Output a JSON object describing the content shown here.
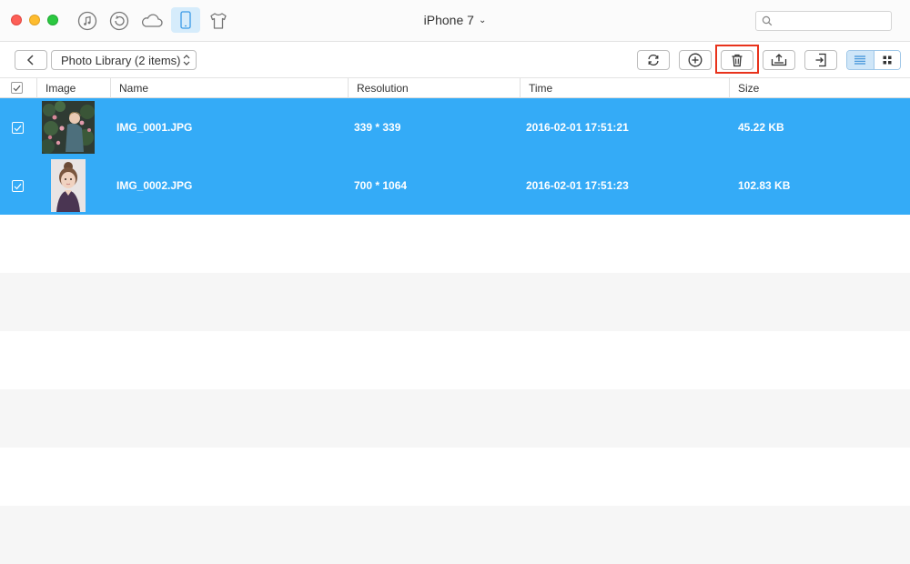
{
  "window": {
    "title": "iPhone 7",
    "search": {
      "placeholder": "",
      "value": ""
    }
  },
  "toolbar": {
    "library_label": "Photo Library (2 items)",
    "buttons": [
      "refresh-icon",
      "add-icon",
      "delete-icon",
      "export-icon",
      "send-to-device-icon"
    ],
    "view_mode": "list"
  },
  "table": {
    "columns": [
      "Image",
      "Name",
      "Resolution",
      "Time",
      "Size"
    ],
    "rows": [
      {
        "name": "IMG_0001.JPG",
        "resolution": "339 * 339",
        "time": "2016-02-01 17:51:21",
        "size": "45.22 KB",
        "selected": true
      },
      {
        "name": "IMG_0002.JPG",
        "resolution": "700 * 1064",
        "time": "2016-02-01 17:51:23",
        "size": "102.83 KB",
        "selected": true
      }
    ]
  },
  "colors": {
    "selection": "#34abf7",
    "highlight_box": "#e8331c",
    "active_tab": "#d6ecfb"
  }
}
